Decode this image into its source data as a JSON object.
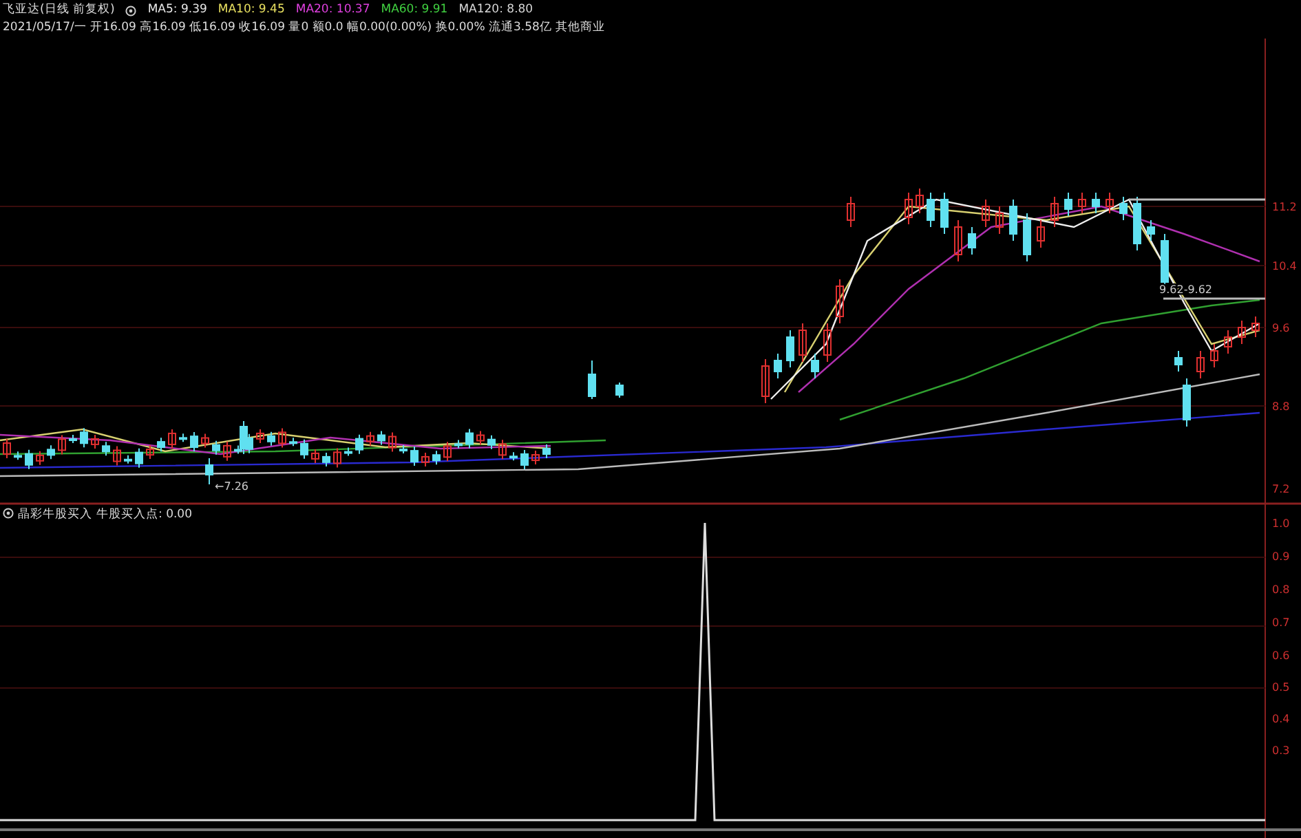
{
  "header": {
    "title": "飞亚达(日线 前复权)",
    "moving_averages": [
      {
        "label": "MA5: 9.39",
        "color": "#e8e8e8"
      },
      {
        "label": "MA10: 9.45",
        "color": "#e8e060"
      },
      {
        "label": "MA20: 10.37",
        "color": "#e040e0"
      },
      {
        "label": "MA60: 9.91",
        "color": "#40d040"
      },
      {
        "label": "MA120: 8.80",
        "color": "#d8d8d8"
      }
    ],
    "quote": "2021/05/17/一 开16.09 高16.09 低16.09 收16.09 量0 额0.0 幅0.00(0.00%) 换0.00% 流通3.58亿 其他商业"
  },
  "price_chart": {
    "axis_labels": [
      "11.2",
      "10.4",
      "9.6",
      "8.8",
      "7.2"
    ],
    "low_label": "←7.26",
    "range_label": "9.62-9.62"
  },
  "indicator": {
    "title": "晶彩牛股买入",
    "value_label": "牛股买入点: 0.00",
    "axis_labels": [
      "1.0",
      "0.9",
      "0.8",
      "0.7",
      "0.6",
      "0.5",
      "0.4",
      "0.3"
    ]
  }
}
